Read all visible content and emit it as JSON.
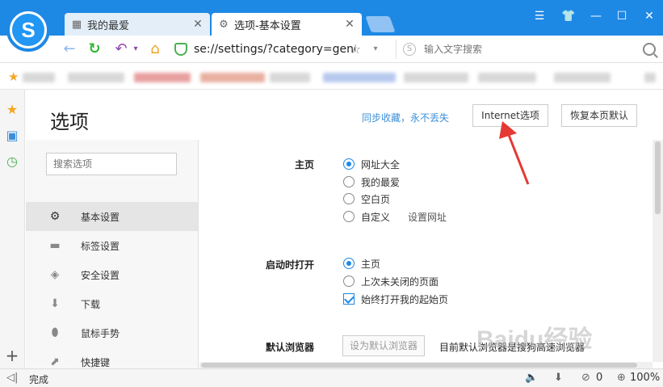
{
  "tabs": [
    {
      "label": "我的最爱",
      "icon": "grid-icon"
    },
    {
      "label": "选项-基本设置",
      "icon": "gear-icon"
    }
  ],
  "address": {
    "url": "se://settings/?category=general",
    "search_placeholder": "输入文字搜索"
  },
  "page": {
    "title": "选项",
    "sync_link": "同步收藏，永不丢失",
    "internet_options_button": "Internet选项",
    "restore_button": "恢复本页默认"
  },
  "nav": {
    "search_placeholder": "搜索选项",
    "items": [
      {
        "label": "基本设置",
        "icon": "gear-icon"
      },
      {
        "label": "标签设置",
        "icon": "tab-icon"
      },
      {
        "label": "安全设置",
        "icon": "shield-check-icon"
      },
      {
        "label": "下载",
        "icon": "download-icon"
      },
      {
        "label": "鼠标手势",
        "icon": "mouse-icon"
      },
      {
        "label": "快捷键",
        "icon": "shortcut-arrow-icon"
      }
    ]
  },
  "settings": {
    "homepage": {
      "label": "主页",
      "options": [
        "网址大全",
        "我的最爱",
        "空白页",
        "自定义"
      ],
      "set_url_link": "设置网址"
    },
    "startup": {
      "label": "启动时打开",
      "options": [
        "主页",
        "上次未关闭的页面"
      ],
      "always_open_label": "始终打开我的起始页"
    },
    "default_browser": {
      "label": "默认浏览器",
      "button": "设为默认浏览器",
      "status": "目前默认浏览器是搜狗高速浏览器"
    }
  },
  "status": {
    "text": "完成",
    "badge_count": "0",
    "zoom": "100%"
  },
  "watermark": "Baidu经验"
}
